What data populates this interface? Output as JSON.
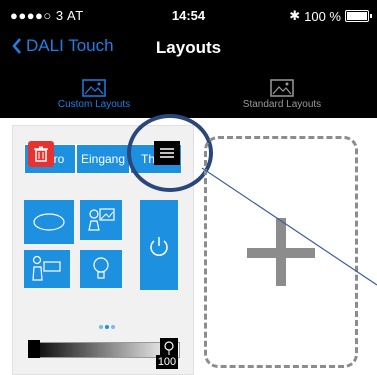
{
  "status_bar": {
    "carrier": "●●●●○ 3 AT",
    "time": "14:54",
    "battery": "100 %"
  },
  "nav": {
    "back_label": "DALI Touch",
    "title": "Layouts"
  },
  "tabs": [
    {
      "label": "Custom Layouts",
      "active": true
    },
    {
      "label": "Standard Layouts",
      "active": false
    }
  ],
  "layout_card": {
    "buttons": [
      "ro",
      "Eingang",
      "Th"
    ],
    "slider_value": "100",
    "page_dots": 3
  },
  "colors": {
    "accent": "#1f7fe6",
    "tile": "#1e90e0",
    "delete": "#e8322f",
    "highlight": "#29477a"
  }
}
